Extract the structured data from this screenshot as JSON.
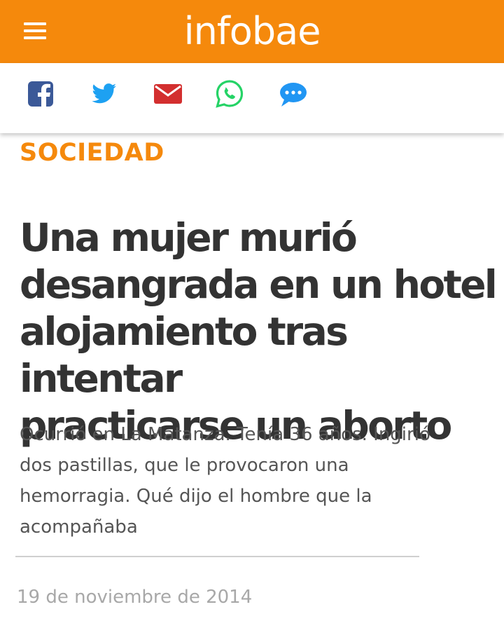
{
  "header": {
    "logo_text": "infobae",
    "background_color": "#f5890c",
    "menu_icon": "hamburger-menu-icon"
  },
  "share_bar": {
    "items": [
      {
        "icon": "facebook-icon",
        "color": "#3b5998"
      },
      {
        "icon": "twitter-icon",
        "color": "#1da1f2"
      },
      {
        "icon": "email-icon",
        "color": "#d32f2f"
      },
      {
        "icon": "whatsapp-icon",
        "color": "#25d366"
      },
      {
        "icon": "comment-icon",
        "color": "#2196f3"
      }
    ]
  },
  "article": {
    "section": "SOCIEDAD",
    "headline_lines": [
      "Una mujer murió",
      "desangrada en un hotel",
      "alojamiento tras intentar",
      "practicarse un aborto"
    ],
    "subtitle_lines": [
      "Ocurrió en La Matanza. Tenía 36 años. Ingirió",
      "dos pastillas, que le provocaron una",
      "hemorragia. Qué dijo el hombre que la",
      "acompañaba"
    ],
    "date": "19 de noviembre de 2014"
  }
}
